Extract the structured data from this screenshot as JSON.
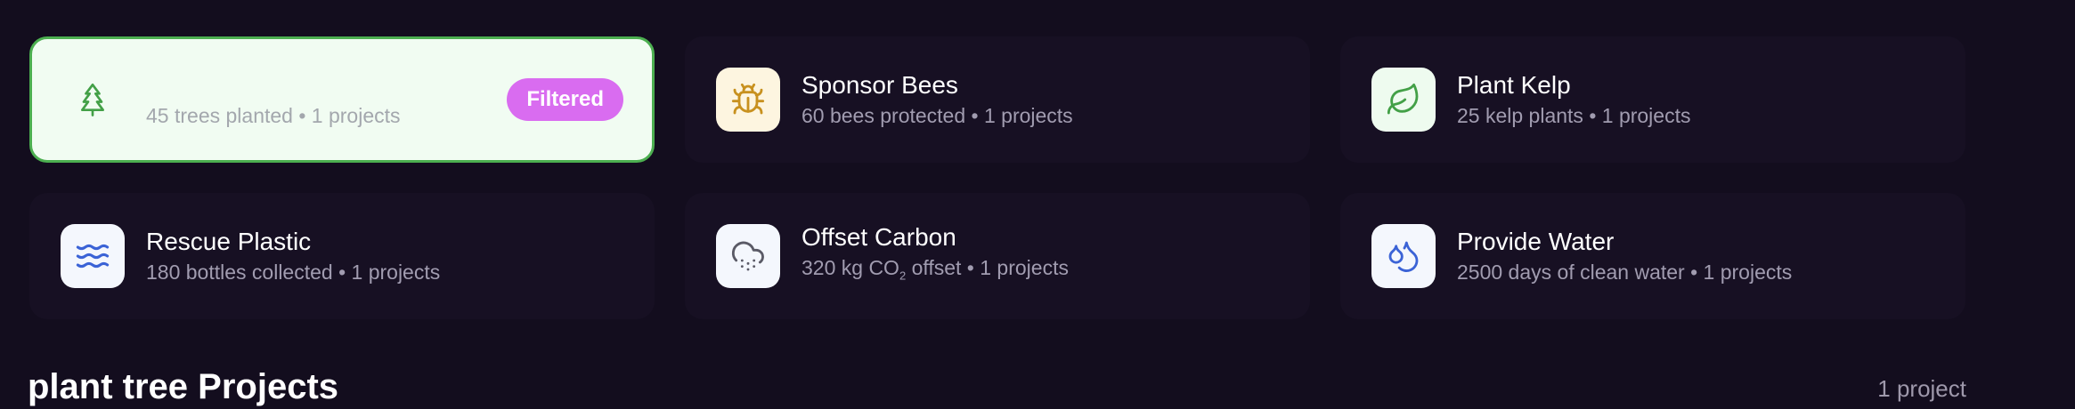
{
  "cards": [
    {
      "id": "plant-tree",
      "title": "",
      "subtitle": "45 trees planted • 1 projects",
      "icon": "tree-icon",
      "selected": true,
      "badge": "Filtered",
      "icon_color": "#43a047"
    },
    {
      "id": "sponsor-bees",
      "title": "Sponsor Bees",
      "subtitle": "60 bees protected • 1 projects",
      "icon": "bug-icon",
      "icon_color": "#c8911f",
      "icon_bg": "#fdf5e0"
    },
    {
      "id": "plant-kelp",
      "title": "Plant Kelp",
      "subtitle": "25 kelp plants • 1 projects",
      "icon": "leaf-icon",
      "icon_color": "#43a047"
    },
    {
      "id": "rescue-plastic",
      "title": "Rescue Plastic",
      "subtitle": "180 bottles collected • 1 projects",
      "icon": "waves-icon",
      "icon_color": "#3b63d6"
    },
    {
      "id": "offset-carbon",
      "title": "Offset Carbon",
      "subtitle_prefix": "320 kg CO",
      "subtitle_sub": "2",
      "subtitle_suffix": " offset • 1 projects",
      "icon": "cloud-snow-icon",
      "icon_color": "#5a5a66"
    },
    {
      "id": "provide-water",
      "title": "Provide Water",
      "subtitle": "2500 days of clean water • 1 projects",
      "icon": "droplets-icon",
      "icon_color": "#3b63d6"
    }
  ],
  "section": {
    "title": "plant tree Projects",
    "count": "1 project"
  },
  "colors": {
    "background": "#130d1e",
    "selected_border": "#4caf50",
    "badge": "#d96cf0"
  }
}
